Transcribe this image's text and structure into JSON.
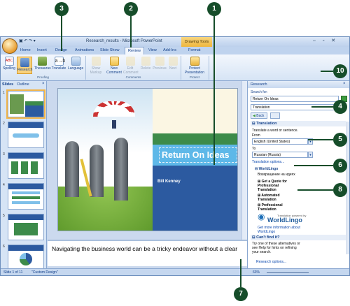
{
  "window": {
    "title": "Research_results - Microsoft PowerPoint",
    "context_tab_title": "Drawing Tools",
    "controls": "– ▫ ✕"
  },
  "tabs": [
    "Home",
    "Insert",
    "Design",
    "Animations",
    "Slide Show",
    "Review",
    "View",
    "Add-Ins",
    "Format"
  ],
  "active_tab": "Review",
  "ribbon": {
    "proofing": {
      "label": "Proofing",
      "buttons": [
        "Spelling",
        "Research",
        "Thesaurus",
        "Translate",
        "Language"
      ]
    },
    "comments": {
      "label": "Comments",
      "buttons": [
        "Show Markup",
        "New Comment",
        "Edit Comment",
        "Delete",
        "Previous",
        "Next"
      ]
    },
    "protect": {
      "label": "Protect",
      "buttons": [
        "Protect Presentation"
      ]
    }
  },
  "left_pane": {
    "tabs": [
      "Slides",
      "Outline"
    ],
    "close": "×",
    "slide_numbers": [
      "1",
      "2",
      "3",
      "4",
      "5",
      "6"
    ]
  },
  "slide": {
    "title": "Return On Ideas",
    "subtitle": "Bill Kenney"
  },
  "notes": {
    "text": "Navigating the business world can be a tricky endeavor without a clear"
  },
  "research_pane": {
    "title": "Research",
    "close": "×",
    "search_for_label": "Search for:",
    "search_value": "Return On Ideas",
    "service": "Translation",
    "back_label": "Back",
    "section_translation": "Translation",
    "translate_desc": "Translate a word or sentence.",
    "from_label": "From",
    "from_value": "English (United States)",
    "to_label": "To",
    "to_value": "Russian (Russia)",
    "translation_options": "Translation options...",
    "worldlingo": "WorldLingo",
    "translated_text": "Возвращение на идеях",
    "get_quote": "Get a Quote for Professional Translation",
    "automated": "Automated Translation",
    "professional": "Professional Translation",
    "powered_by": "Translation powered by",
    "worldlingo_logo": "WorldLingo",
    "more_info": "Get more information about WorldLingo",
    "cant_find": "Can't find it?",
    "try_text": "Try one of these alternatives or see Help for hints on refining your search.",
    "research_options": "Research options..."
  },
  "status_bar": {
    "slide_info": "Slide 1 of 11",
    "theme": "\"Custom Design\"",
    "zoom": "63%"
  },
  "callouts": [
    "1",
    "2",
    "3",
    "4",
    "5",
    "6",
    "7",
    "8",
    "10"
  ],
  "colors": {
    "callout": "#164d2a",
    "ribbon_text": "#15428b",
    "slide_green": "#3d8b4a",
    "slide_blue": "#2c5aa0"
  }
}
